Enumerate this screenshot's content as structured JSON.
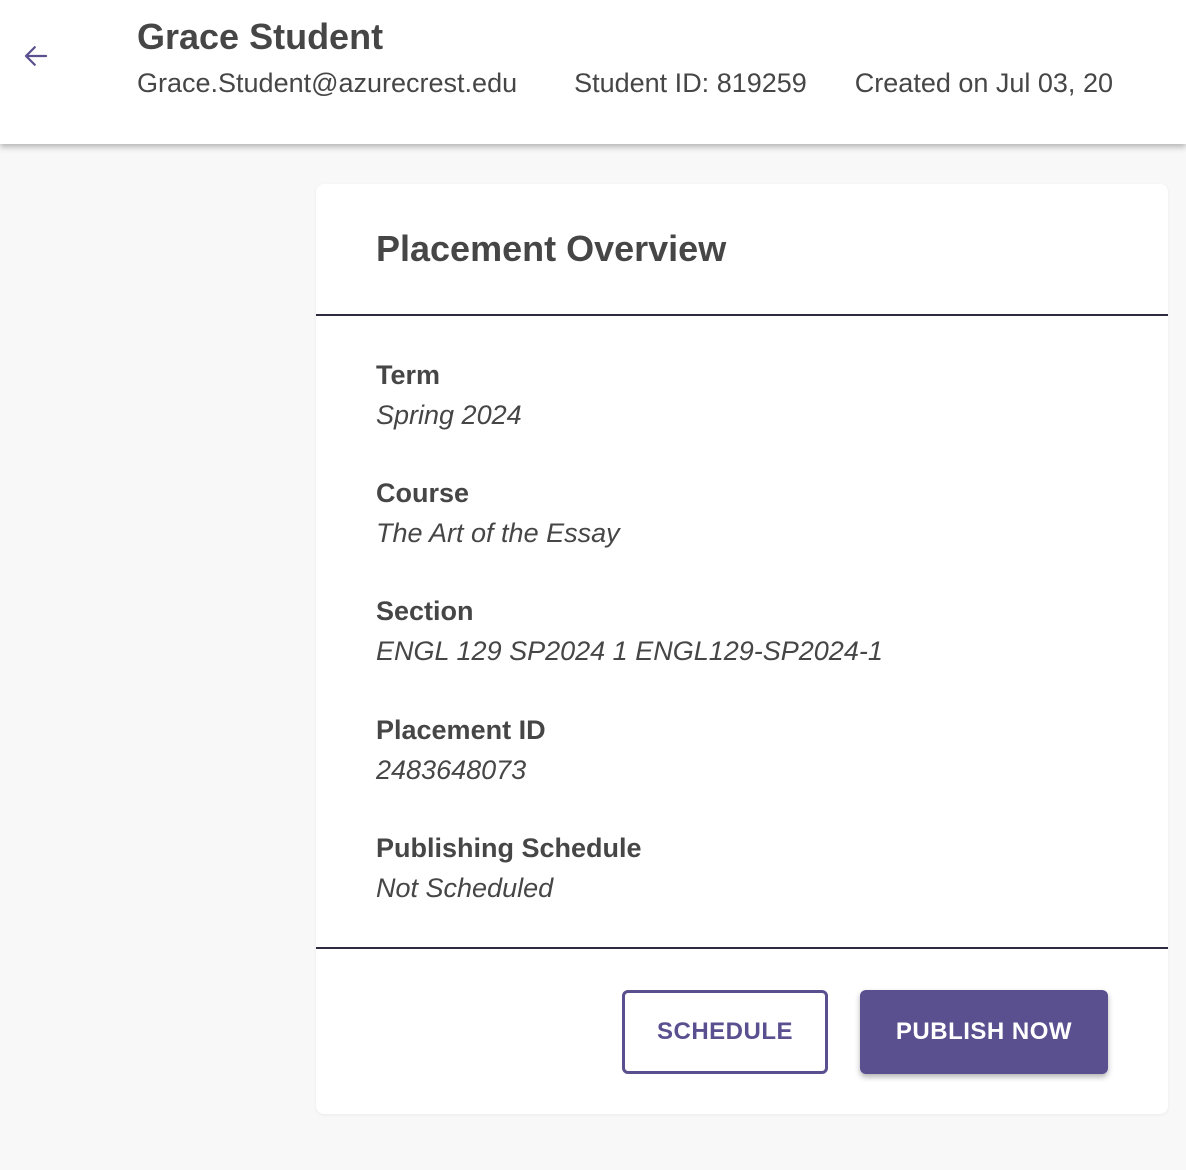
{
  "header": {
    "student_name": "Grace Student",
    "email": "Grace.Student@azurecrest.edu",
    "student_id": "Student ID: 819259",
    "created_on": "Created on Jul 03, 20"
  },
  "card": {
    "title": "Placement Overview",
    "fields": [
      {
        "label": "Term",
        "value": "Spring 2024"
      },
      {
        "label": "Course",
        "value": "The Art of the Essay"
      },
      {
        "label": "Section",
        "value": "ENGL 129 SP2024 1 ENGL129-SP2024-1"
      },
      {
        "label": "Placement ID",
        "value": "2483648073"
      },
      {
        "label": "Publishing Schedule",
        "value": "Not Scheduled"
      }
    ],
    "actions": {
      "schedule_label": "SCHEDULE",
      "publish_label": "PUBLISH NOW"
    }
  },
  "icons": {
    "back": "arrow-left-icon"
  },
  "colors": {
    "accent": "#5a4f8f",
    "background": "#f8f8f8",
    "text": "#464646",
    "divider": "#2c2b3f"
  }
}
